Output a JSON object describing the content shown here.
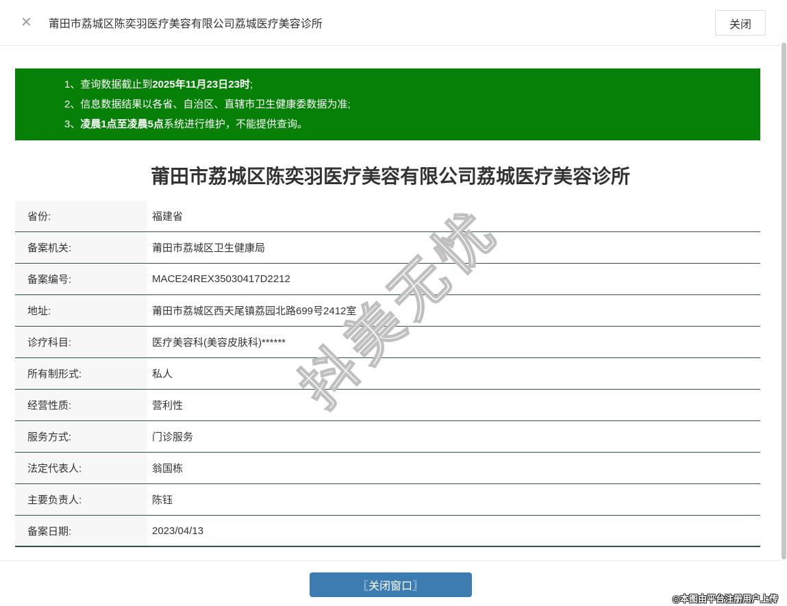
{
  "colors": {
    "green": "#078007",
    "blue": "#3d7cb1",
    "line": "#2b5248",
    "label-bg": "#f7f7f7",
    "text": "#333333",
    "muted": "#9b9b9b",
    "border-light": "#e8e8e8"
  },
  "header": {
    "close_icon": "✕",
    "title": "莆田市荔城区陈奕羽医疗美容有限公司荔城医疗美容诊所",
    "close_button": "关闭"
  },
  "notice": {
    "lines": [
      {
        "pre": "1、查询数据截止到",
        "bold": "2025年11月23日23时",
        "post": ";"
      },
      {
        "pre": "2、信息数据结果以各省、自治区、直辖市卫生健康委数据为准;",
        "bold": "",
        "post": ""
      },
      {
        "pre": "3、",
        "bold": "凌晨1点至凌晨5点",
        "post": "系统进行维护，不能提供查询。"
      }
    ]
  },
  "main": {
    "title": "莆田市荔城区陈奕羽医疗美容有限公司荔城医疗美容诊所"
  },
  "table": {
    "rows": [
      {
        "label": "省份:",
        "value": "福建省"
      },
      {
        "label": "备案机关:",
        "value": "莆田市荔城区卫生健康局"
      },
      {
        "label": "备案编号:",
        "value": "MACE24REX35030417D2212"
      },
      {
        "label": "地址:",
        "value": "莆田市荔城区西天尾镇荔园北路699号2412室"
      },
      {
        "label": "诊疗科目:",
        "value": "医疗美容科(美容皮肤科)******"
      },
      {
        "label": "所有制形式:",
        "value": "私人"
      },
      {
        "label": "经营性质:",
        "value": "营利性"
      },
      {
        "label": "服务方式:",
        "value": "门诊服务"
      },
      {
        "label": "法定代表人:",
        "value": "翁国栋"
      },
      {
        "label": "主要负责人:",
        "value": "陈钰"
      },
      {
        "label": "备案日期:",
        "value": "2023/04/13"
      }
    ]
  },
  "footer": {
    "close_button": "〖关闭窗口〗",
    "upload_note": "◎本图由平台注册用户上传"
  },
  "watermark": "抖美无忧"
}
